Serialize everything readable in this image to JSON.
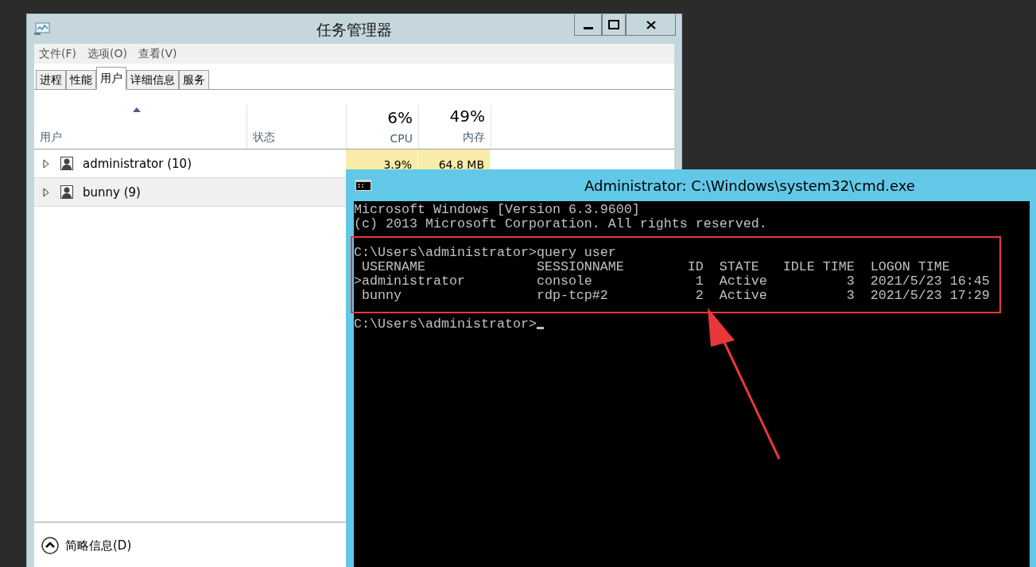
{
  "task_manager": {
    "title": "任务管理器",
    "menu": [
      "文件(F)",
      "选项(O)",
      "查看(V)"
    ],
    "tabs": [
      {
        "label": "进程",
        "selected": false
      },
      {
        "label": "性能",
        "selected": false
      },
      {
        "label": "用户",
        "selected": true
      },
      {
        "label": "详细信息",
        "selected": false
      },
      {
        "label": "服务",
        "selected": false
      }
    ],
    "columns": [
      {
        "label": "用户",
        "sorted": true
      },
      {
        "label": "状态",
        "sorted": false
      },
      {
        "summary": "6%",
        "label": "CPU",
        "sorted": false
      },
      {
        "summary": "49%",
        "label": "内存",
        "sorted": false
      }
    ],
    "rows": [
      {
        "name": "administrator (10)",
        "expanded": false,
        "selected": false,
        "cpu": "3.9%",
        "memory": "64.8 MB"
      },
      {
        "name": "bunny (9)",
        "expanded": false,
        "selected": true
      }
    ],
    "footer": "简略信息(D)"
  },
  "console": {
    "title": "Administrator: C:\\Windows\\system32\\cmd.exe",
    "blocks": [
      {
        "highlighted": false,
        "lines": [
          "Microsoft Windows [Version 6.3.9600]",
          "(c) 2013 Microsoft Corporation. All rights reserved."
        ]
      },
      {
        "highlighted": true,
        "lines": [
          "C:\\Users\\administrator>query user",
          " USERNAME              SESSIONNAME        ID  STATE   IDLE TIME  LOGON TIME",
          ">administrator         console             1  Active          3  2021/5/23 16:45",
          " bunny                 rdp-tcp#2           2  Active          3  2021/5/23 17:29"
        ]
      },
      {
        "highlighted": false,
        "lines": [
          "C:\\Users\\administrator>"
        ]
      }
    ],
    "cursor": true
  }
}
